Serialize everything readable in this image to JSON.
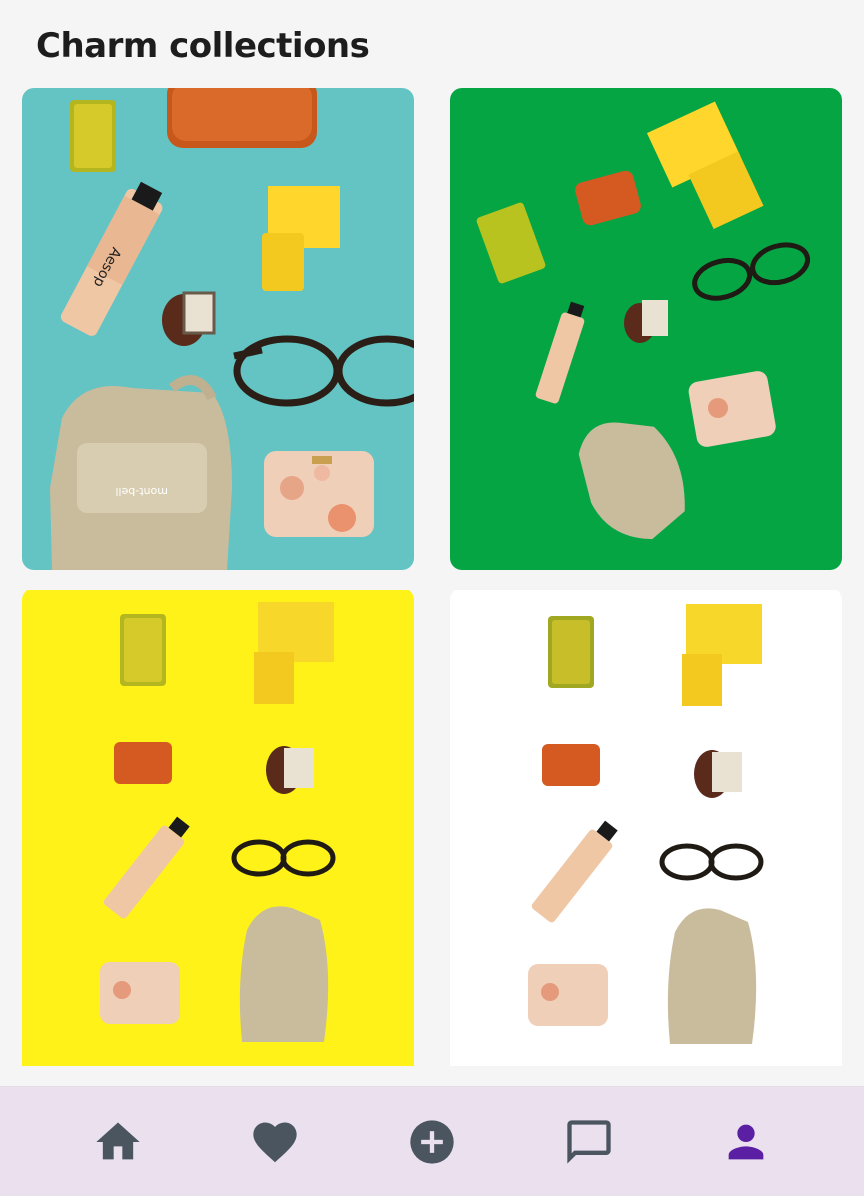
{
  "page": {
    "title": "Charm collections"
  },
  "collections": [
    {
      "background": "#64c3c3",
      "name": "teal"
    },
    {
      "background": "#05a544",
      "name": "green"
    },
    {
      "background": "#fef218",
      "name": "yellow"
    },
    {
      "background": "#ffffff",
      "name": "white"
    }
  ],
  "item_labels": {
    "tube_text": "Aesop",
    "backpack_logo": "mont-bell"
  },
  "nav": {
    "items": [
      {
        "icon": "home-icon",
        "active": false
      },
      {
        "icon": "heart-icon",
        "active": false
      },
      {
        "icon": "add-icon",
        "active": false
      },
      {
        "icon": "chat-icon",
        "active": false
      },
      {
        "icon": "profile-icon",
        "active": true
      }
    ],
    "colors": {
      "inactive": "#4a5560",
      "active": "#5b1fa3",
      "background": "#ebe0ee"
    }
  }
}
